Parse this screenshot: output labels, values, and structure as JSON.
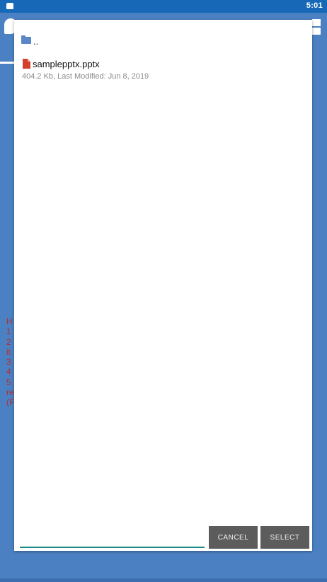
{
  "status_bar": {
    "time": "5:01"
  },
  "background": {
    "text_lines": [
      "H",
      "1",
      "2",
      "it",
      "3",
      "4",
      "5",
      "re",
      "(F"
    ]
  },
  "dialog": {
    "parent_dir_label": "..",
    "files": [
      {
        "name": "samplepptx.pptx",
        "meta": "404.2 Kb, Last Modified: Jun 8, 2019"
      }
    ],
    "filename_input": {
      "value": "",
      "placeholder": ""
    },
    "cancel_label": "CANCEL",
    "select_label": "SELECT"
  },
  "colors": {
    "status_bar": "#1769b8",
    "background": "#4b80c3",
    "folder_icon": "#5b86c8",
    "file_icon": "#d23f2f",
    "input_underline": "#1c8a87",
    "button": "#5c5c5c"
  }
}
